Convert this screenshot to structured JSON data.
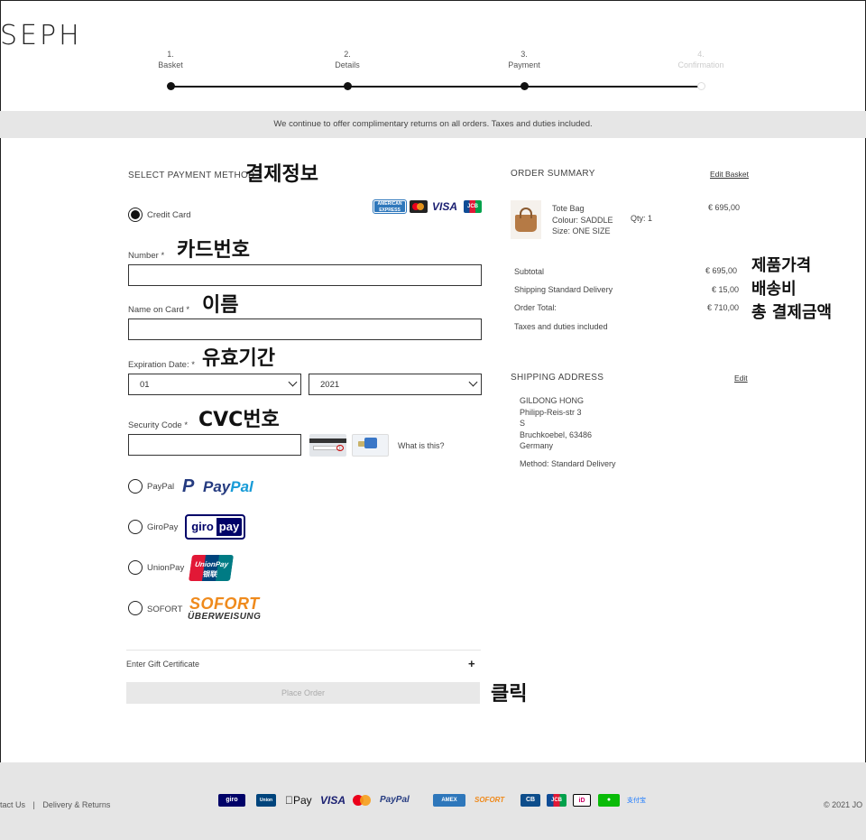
{
  "brand": {
    "logo": "SEPH"
  },
  "steps": [
    {
      "num": "1.",
      "label": "Basket"
    },
    {
      "num": "2.",
      "label": "Details"
    },
    {
      "num": "3.",
      "label": "Payment"
    },
    {
      "num": "4.",
      "label": "Confirmation"
    }
  ],
  "banner": "We continue to offer complimentary returns on all orders. Taxes and duties included.",
  "payment": {
    "title": "SELECT PAYMENT METHOD",
    "annot_title": "결제정보",
    "credit_card": "Credit Card",
    "card_brands": [
      "AMERICAN EXPRESS",
      "mastercard",
      "VISA",
      "JCB"
    ],
    "number_label": "Number",
    "annot_number": "카드번호",
    "name_label": "Name on Card",
    "annot_name": "이름",
    "exp_label": "Expiration Date:",
    "annot_exp": "유효기간",
    "month": "01",
    "year": "2021",
    "cvc_label": "Security Code",
    "annot_cvc": "CVC번호",
    "what_is_this": "What is this?",
    "required": "*",
    "paypal": "PayPal",
    "paypal_logo_a": "Pay",
    "paypal_logo_b": "Pal",
    "giropay": "GiroPay",
    "giropay_logo_a": "giro",
    "giropay_logo_b": "pay",
    "unionpay": "UnionPay",
    "unionpay_logo": "UnionPay",
    "unionpay_logo_cn": "银联",
    "sofort": "SOFORT",
    "sofort_logo": "SOFORT",
    "sofort_sub": "ÜBERWEISUNG",
    "gift": "Enter Gift Certificate",
    "gift_plus": "+",
    "place_order": "Place Order",
    "annot_click": "클릭"
  },
  "summary": {
    "title": "ORDER SUMMARY",
    "edit_basket": "Edit Basket",
    "item_name": "Tote Bag",
    "item_colour": "Colour: SADDLE",
    "item_size": "Size: ONE SIZE",
    "item_qty": "Qty: 1",
    "item_price": "€ 695,00",
    "subtotal_label": "Subtotal",
    "subtotal": "€ 695,00",
    "annot_subtotal": "제품가격",
    "shipping_label": "Shipping Standard Delivery",
    "shipping": "€ 15,00",
    "annot_shipping": "배송비",
    "total_label": "Order Total:",
    "total": "€ 710,00",
    "annot_total": "총 결제금액",
    "taxes": "Taxes and duties included"
  },
  "address": {
    "title": "SHIPPING ADDRESS",
    "edit": "Edit",
    "lines": [
      "GILDONG HONG",
      "Philipp-Reis-str 3",
      "S",
      "Bruchkoebel, 63486",
      "Germany"
    ],
    "method": "Method: Standard Delivery"
  },
  "footer": {
    "left": "tact Us",
    "sep": "|",
    "delivery": "Delivery & Returns",
    "right": "© 2021 JO",
    "icons": [
      "giropay",
      "UnionPay",
      "Apple Pay",
      "VISA",
      "mastercard",
      "PayPal",
      "AMERICAN EXPRESS",
      "SOFORT",
      "CB",
      "JCB",
      "iD",
      "WeChat",
      "Alipay"
    ],
    "icon_texts": [
      "giro",
      "Union",
      "Pay",
      "VISA",
      "",
      "PayPal",
      "AMEX",
      "SOFORT",
      "CB",
      "JCB",
      "iD",
      "",
      "支付宝"
    ]
  }
}
